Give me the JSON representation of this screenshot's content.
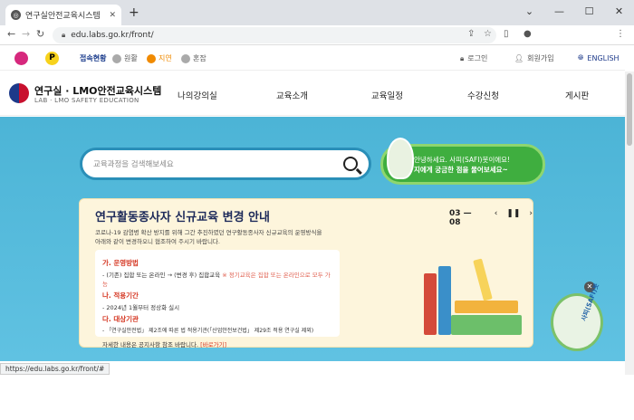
{
  "browser": {
    "tab_title": "연구실안전교육시스템",
    "url": "edu.labs.go.kr/front/",
    "status_url": "https://edu.labs.go.kr/front/#"
  },
  "topbar": {
    "status_label": "접속현황",
    "statuses": [
      "원활",
      "지연",
      "혼잡"
    ],
    "login": "로그인",
    "join": "회원가입",
    "english": "ENGLISH"
  },
  "header": {
    "site_title": "연구실 · LMO안전교육시스템",
    "site_subtitle": "LAB · LMO SAFETY EDUCATION",
    "menu": [
      "나의강의실",
      "교육소개",
      "교육일정",
      "수강신청",
      "게시판"
    ]
  },
  "hero": {
    "search_placeholder": "교육과정을 검색해보세요",
    "bubble_line1": "안녕하세요. 사피(SAFI)봇이에요!",
    "bubble_line2": "지에게 궁금한 점을 물어보세요~"
  },
  "notice": {
    "title": "연구활동종사자 신규교육 변경 안내",
    "pager": "03 — 08",
    "desc_line1": "코로나-19 감염병 확산 방지를 위해 그간 추진하였던 연구활동종사자 신규교육의 운영방식을",
    "desc_line2": "아래와 같이 변경하오니 협조하여 주시기 바랍니다.",
    "sec1_title": "가. 운영방법",
    "sec1_item": "- (기존) 집합 또는 온라인 → (변경 후) 집합교육",
    "sec1_note": "※ 정기교육은 집합 또는 온라인으로 모두 가능",
    "sec2_title": "나. 적용기간",
    "sec2_item": "- 2024년 1월부터 정상화 실시",
    "sec3_title": "다. 대상기관",
    "sec3_item": "- 「연구실안전법」 제2조에 따른 법 적용기관(「산업안전보건법」 제29조 적용 연구실 제외)",
    "footer_text": "자세한 내용은 공지사항 참조 바랍니다.",
    "footer_link": "[바로가기]"
  },
  "mascot_label": "사피(SAFI)봇",
  "colors": {
    "primary": "#1d3a8a",
    "accent_red": "#d4331e",
    "hero_bg": "#4cb4d6",
    "bot_green": "#3fae3f"
  }
}
